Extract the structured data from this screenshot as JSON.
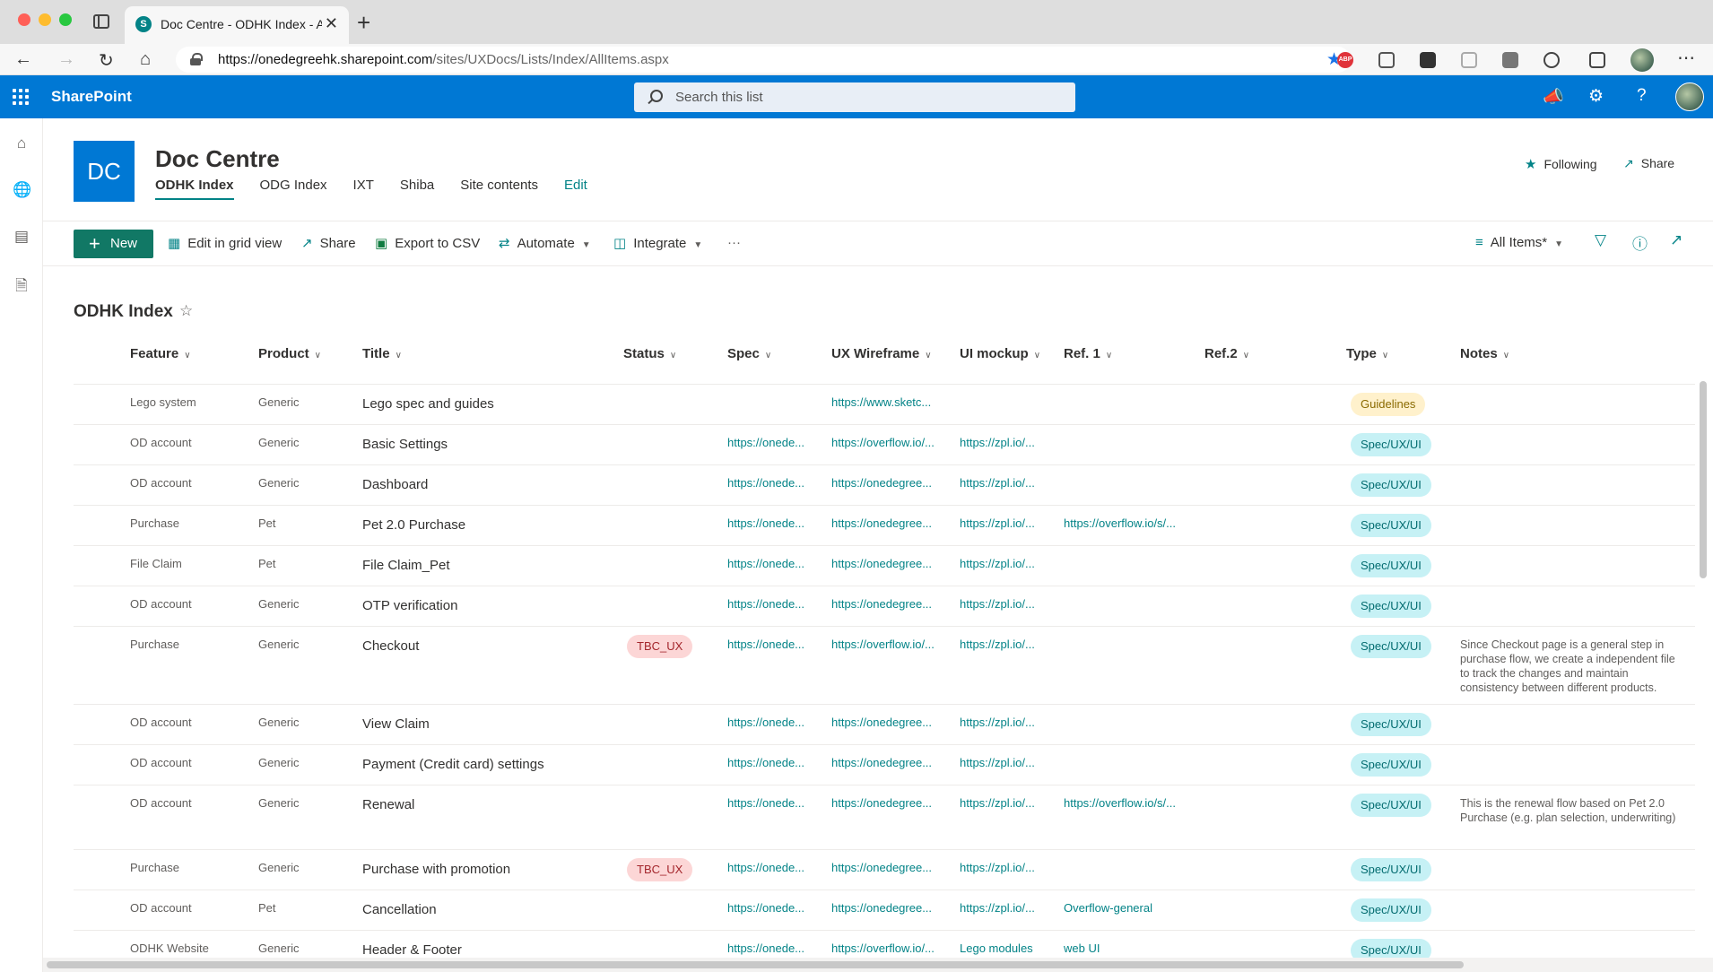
{
  "browser": {
    "tab_title": "Doc Centre - ODHK Index - All",
    "tab_favicon": "S",
    "new_tab": "+",
    "close": "✕",
    "url_host": "https://onedegreehk.sharepoint.com",
    "url_path": "/sites/UXDocs/Lists/Index/AllItems.aspx",
    "ext_badge": "ABP"
  },
  "suite": {
    "brand": "SharePoint",
    "search_placeholder": "Search this list"
  },
  "site": {
    "logo": "DC",
    "title": "Doc Centre",
    "nav": [
      {
        "label": "ODHK Index"
      },
      {
        "label": "ODG Index"
      },
      {
        "label": "IXT"
      },
      {
        "label": "Shiba"
      },
      {
        "label": "Site contents"
      },
      {
        "label": "Edit"
      }
    ],
    "following_label": "Following",
    "share_label": "Share"
  },
  "commands": {
    "new_label": "New",
    "edit_grid_label": "Edit in grid view",
    "share_label": "Share",
    "export_label": "Export to CSV",
    "automate_label": "Automate",
    "integrate_label": "Integrate",
    "more_label": "···",
    "view_label": "All Items*"
  },
  "list": {
    "title": "ODHK Index",
    "columns": [
      "Feature",
      "Product",
      "Title",
      "Status",
      "Spec",
      "UX Wireframe",
      "UI mockup",
      "Ref. 1",
      "Ref.2",
      "Type",
      "Notes"
    ],
    "rows": [
      {
        "feature": "Lego system",
        "product": "Generic",
        "title": "Lego spec and guides",
        "status": "",
        "spec": "",
        "ux": "https://www.sketc...",
        "ui": "",
        "ref1": "",
        "ref2": "",
        "type": "Guidelines",
        "notes": ""
      },
      {
        "feature": "OD account",
        "product": "Generic",
        "title": "Basic Settings",
        "status": "",
        "spec": "https://onede...",
        "ux": "https://overflow.io/...",
        "ui": "https://zpl.io/...",
        "ref1": "",
        "ref2": "",
        "type": "Spec/UX/UI",
        "notes": ""
      },
      {
        "feature": "OD account",
        "product": "Generic",
        "title": "Dashboard",
        "status": "",
        "spec": "https://onede...",
        "ux": "https://onedegree...",
        "ui": "https://zpl.io/...",
        "ref1": "",
        "ref2": "",
        "type": "Spec/UX/UI",
        "notes": ""
      },
      {
        "feature": "Purchase",
        "product": "Pet",
        "title": "Pet 2.0 Purchase",
        "status": "",
        "spec": "https://onede...",
        "ux": "https://onedegree...",
        "ui": "https://zpl.io/...",
        "ref1": "https://overflow.io/s/...",
        "ref2": "",
        "type": "Spec/UX/UI",
        "notes": ""
      },
      {
        "feature": "File Claim",
        "product": "Pet",
        "title": "File Claim_Pet",
        "status": "",
        "spec": "https://onede...",
        "ux": "https://onedegree...",
        "ui": "https://zpl.io/...",
        "ref1": "",
        "ref2": "",
        "type": "Spec/UX/UI",
        "notes": ""
      },
      {
        "feature": "OD account",
        "product": "Generic",
        "title": "OTP verification",
        "status": "",
        "spec": "https://onede...",
        "ux": "https://onedegree...",
        "ui": "https://zpl.io/...",
        "ref1": "",
        "ref2": "",
        "type": "Spec/UX/UI",
        "notes": ""
      },
      {
        "feature": "Purchase",
        "product": "Generic",
        "title": "Checkout",
        "status": "TBC_UX",
        "spec": "https://onede...",
        "ux": "https://overflow.io/...",
        "ui": "https://zpl.io/...",
        "ref1": "",
        "ref2": "",
        "type": "Spec/UX/UI",
        "notes": "Since Checkout page is a general step in purchase flow, we create a independent file to track the changes and maintain consistency between different products."
      },
      {
        "feature": "OD account",
        "product": "Generic",
        "title": "View Claim",
        "status": "",
        "spec": "https://onede...",
        "ux": "https://onedegree...",
        "ui": "https://zpl.io/...",
        "ref1": "",
        "ref2": "",
        "type": "Spec/UX/UI",
        "notes": ""
      },
      {
        "feature": "OD account",
        "product": "Generic",
        "title": "Payment (Credit card) settings",
        "status": "",
        "spec": "https://onede...",
        "ux": "https://onedegree...",
        "ui": "https://zpl.io/...",
        "ref1": "",
        "ref2": "",
        "type": "Spec/UX/UI",
        "notes": ""
      },
      {
        "feature": "OD account",
        "product": "Generic",
        "title": "Renewal",
        "status": "",
        "spec": "https://onede...",
        "ux": "https://onedegree...",
        "ui": "https://zpl.io/...",
        "ref1": "https://overflow.io/s/...",
        "ref2": "",
        "type": "Spec/UX/UI",
        "notes": "This is the renewal flow based on Pet 2.0 Purchase (e.g. plan selection, underwriting)"
      },
      {
        "feature": "Purchase",
        "product": "Generic",
        "title": "Purchase with promotion",
        "status": "TBC_UX",
        "spec": "https://onede...",
        "ux": "https://onedegree...",
        "ui": "https://zpl.io/...",
        "ref1": "",
        "ref2": "",
        "type": "Spec/UX/UI",
        "notes": ""
      },
      {
        "feature": "OD account",
        "product": "Pet",
        "title": "Cancellation",
        "status": "",
        "spec": "https://onede...",
        "ux": "https://onedegree...",
        "ui": "https://zpl.io/...",
        "ref1": "Overflow-general",
        "ref2": "",
        "type": "Spec/UX/UI",
        "notes": ""
      },
      {
        "feature": "ODHK Website",
        "product": "Generic",
        "title": "Header & Footer",
        "status": "",
        "spec": "https://onede...",
        "ux": "https://overflow.io/...",
        "ui": "Lego modules",
        "ref1": "web UI",
        "ref2": "",
        "type": "Spec/UX/UI",
        "notes": ""
      }
    ]
  },
  "colors": {
    "suite_bar": "#0078d4",
    "accent_teal": "#038387",
    "new_button": "#117865",
    "pill_spec": "#c6f1f5",
    "pill_guidelines": "#fff1cc",
    "pill_tbc": "#fcd6d6"
  },
  "icons": {
    "rail": [
      "home-icon",
      "globe-icon",
      "news-icon",
      "document-icon"
    ],
    "suite_right": [
      "megaphone-icon",
      "gear-icon",
      "help-icon"
    ]
  }
}
